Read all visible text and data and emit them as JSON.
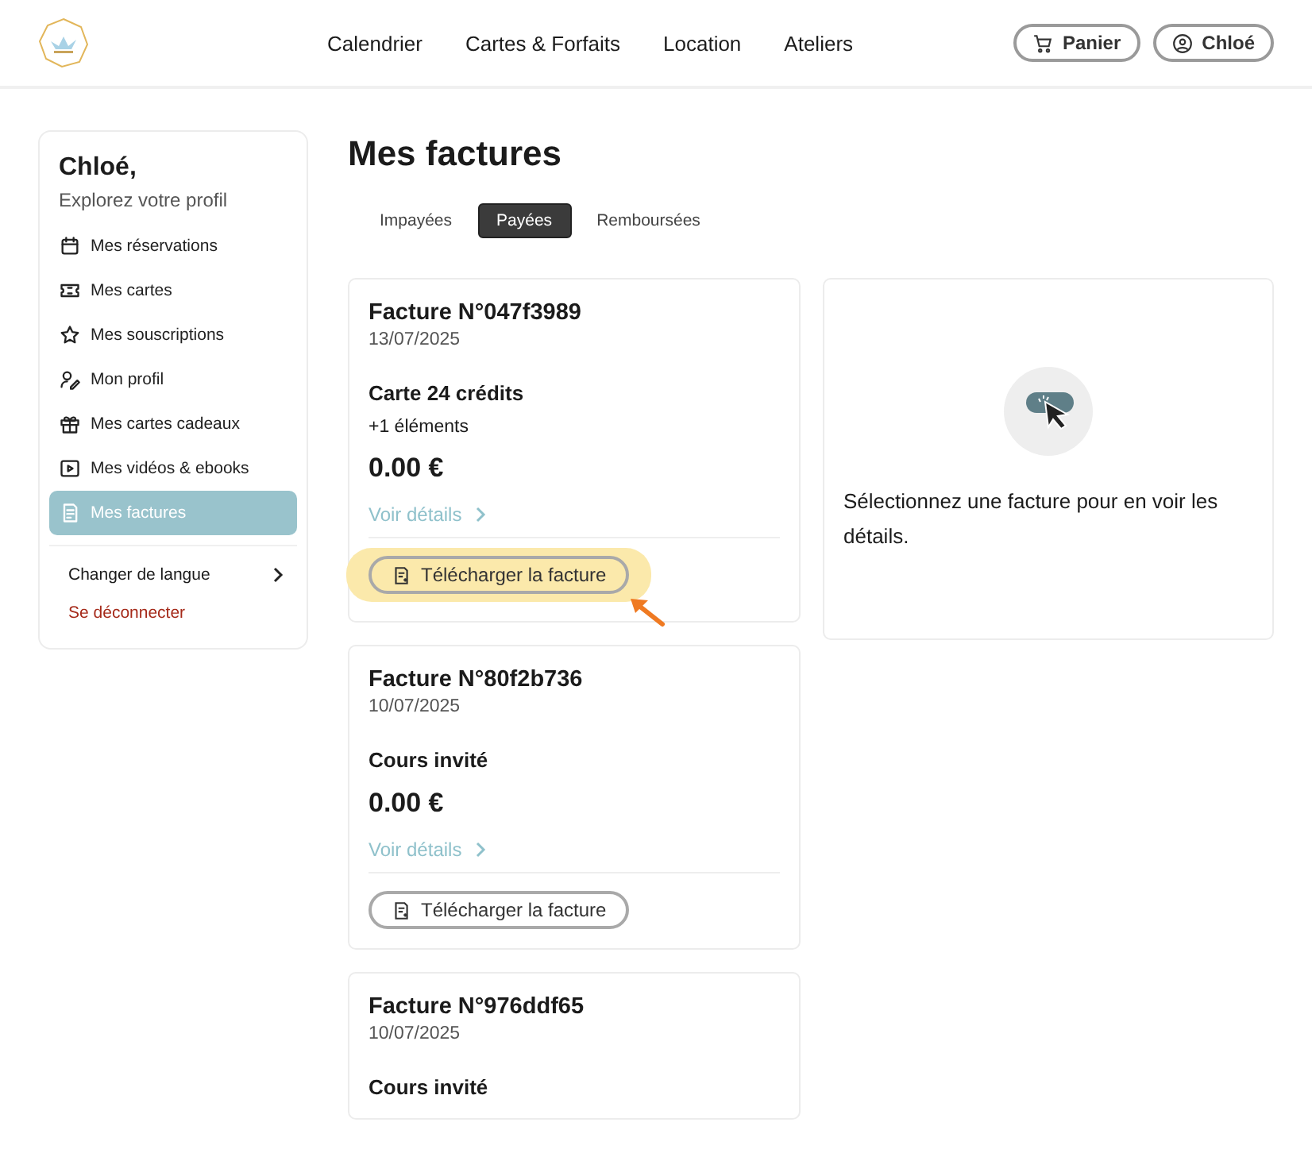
{
  "header": {
    "nav": [
      {
        "label": "Calendrier"
      },
      {
        "label": "Cartes & Forfaits"
      },
      {
        "label": "Location"
      },
      {
        "label": "Ateliers"
      }
    ],
    "actions": [
      {
        "kind": "cart",
        "label": "Panier"
      },
      {
        "kind": "user",
        "label": "Chloé"
      }
    ]
  },
  "sidebar": {
    "greeting": "Chloé,",
    "subtitle": "Explorez votre profil",
    "items": [
      {
        "kind": "calendar",
        "label": "Mes réservations",
        "selected": false
      },
      {
        "kind": "ticket",
        "label": "Mes cartes",
        "selected": false
      },
      {
        "kind": "star",
        "label": "Mes souscriptions",
        "selected": false
      },
      {
        "kind": "profile",
        "label": "Mon profil",
        "selected": false
      },
      {
        "kind": "gift",
        "label": "Mes cartes cadeaux",
        "selected": false
      },
      {
        "kind": "video",
        "label": "Mes vidéos & ebooks",
        "selected": false
      },
      {
        "kind": "invoice",
        "label": "Mes factures",
        "selected": true
      }
    ],
    "language": "Changer de langue",
    "logout": "Se déconnecter"
  },
  "page_title": "Mes factures",
  "tabs": [
    {
      "label": "Impayées",
      "selected": false
    },
    {
      "label": "Payées",
      "selected": true
    },
    {
      "label": "Remboursées",
      "selected": false
    }
  ],
  "invoices": [
    {
      "title": "Facture N°047f3989",
      "date": "13/07/2025",
      "item": "Carte 24 crédits",
      "extra": "+1 éléments",
      "amount": "0.00 €",
      "details_link": "Voir détails",
      "download": "Télécharger la facture",
      "highlighted": true
    },
    {
      "title": "Facture N°80f2b736",
      "date": "10/07/2025",
      "item": "Cours invité",
      "amount": "0.00 €",
      "details_link": "Voir détails",
      "download": "Télécharger la facture",
      "highlighted": false
    },
    {
      "title": "Facture N°976ddf65",
      "date": "10/07/2025",
      "item": "Cours invité",
      "highlighted": false
    }
  ],
  "detail_panel": {
    "message": "Sélectionnez une facture pour en voir les détails."
  }
}
